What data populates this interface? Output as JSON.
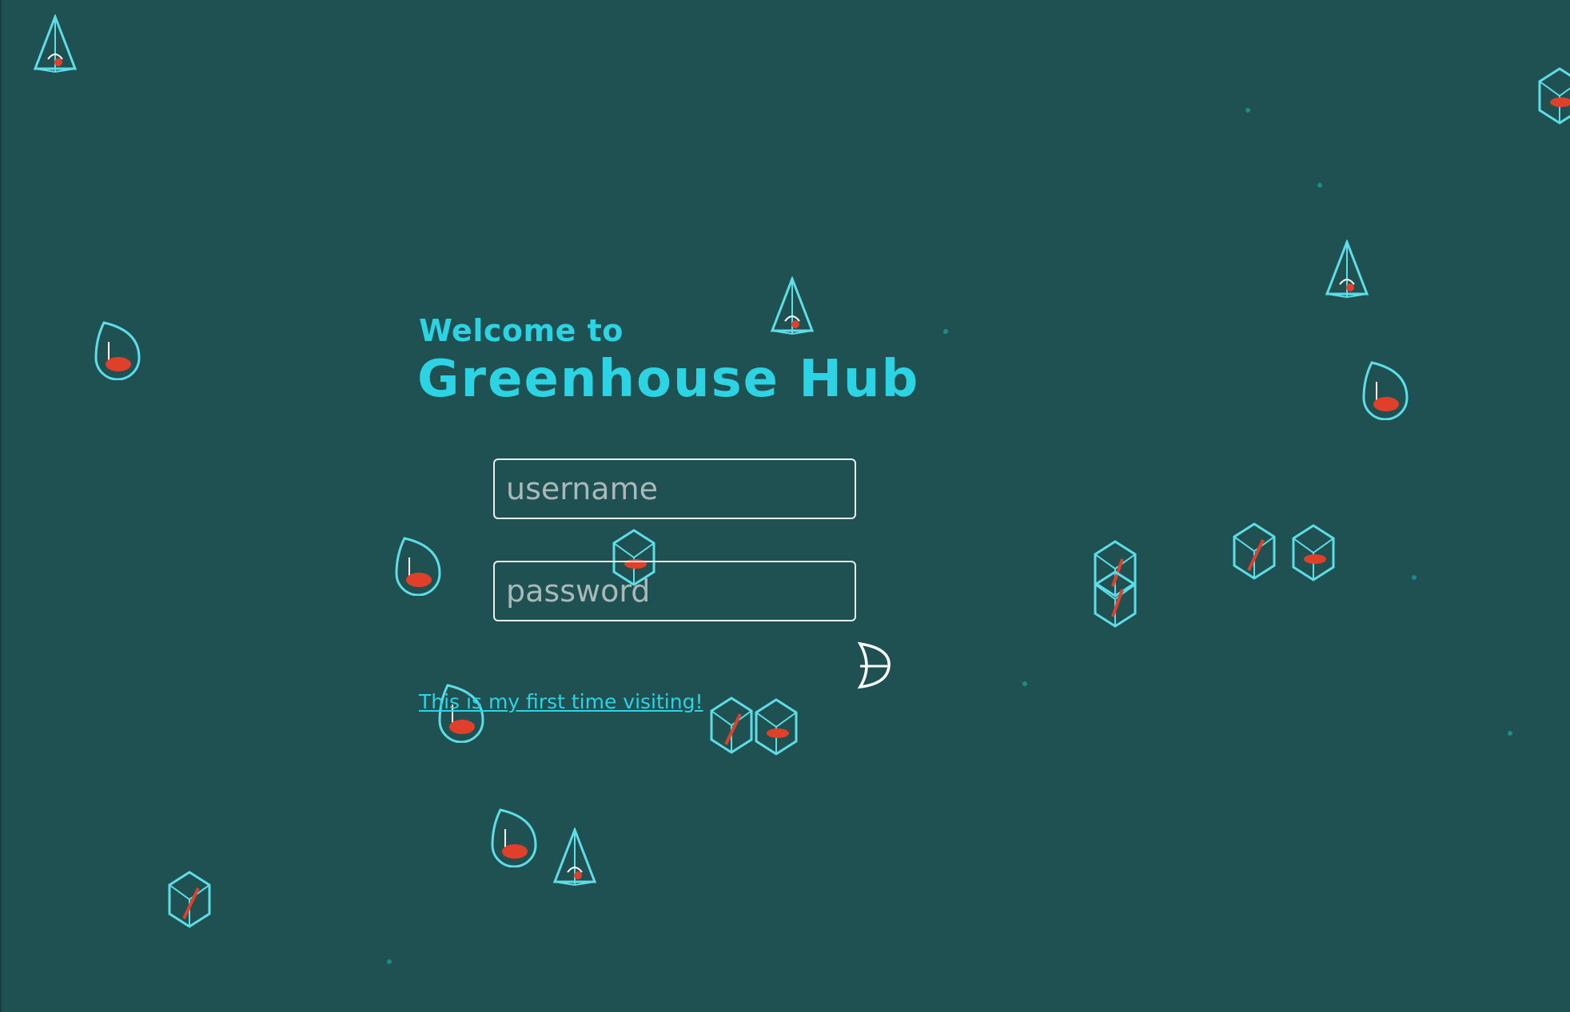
{
  "page": {
    "welcome": "Welcome to",
    "brand": "Greenhouse Hub"
  },
  "login": {
    "username_placeholder": "username",
    "username_value": "",
    "password_placeholder": "password",
    "password_value": "",
    "first_visit_link": "This is my first time visiting!"
  },
  "icons": {
    "submit": "leaf-arrow-icon",
    "decorations": [
      "pyramid-terrarium-icon",
      "teardrop-terrarium-icon",
      "geodesic-terrarium-icon"
    ]
  },
  "colors": {
    "background": "#1f5052",
    "accent": "#2bd3e3",
    "terrarium_outline": "#5fdde6",
    "plant": "#e0402a",
    "field_border": "#e8eeee"
  }
}
